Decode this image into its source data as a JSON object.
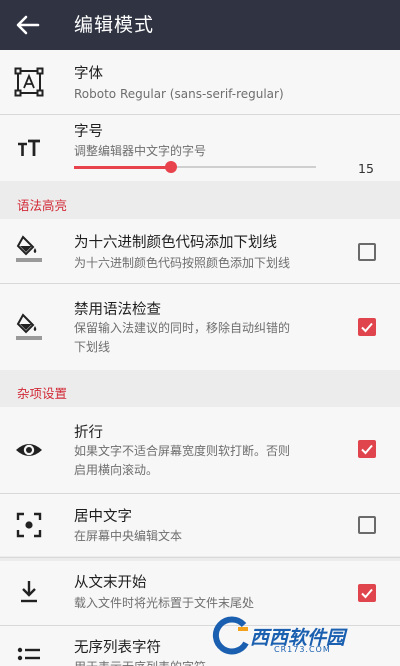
{
  "appbar": {
    "title": "编辑模式"
  },
  "settings": {
    "font": {
      "title": "字体",
      "subtitle": "Roboto Regular (sans-serif-regular)"
    },
    "font_size": {
      "title": "字号",
      "subtitle": "调整编辑器中文字的字号",
      "value": "15",
      "slider_fraction": 0.4
    }
  },
  "syntax_section": {
    "header": "语法高亮",
    "underline_hex": {
      "title": "为十六进制颜色代码添加下划线",
      "subtitle": "为十六进制颜色代码按照颜色添加下划线",
      "checked": false
    },
    "disable_spellcheck": {
      "title": "禁用语法检查",
      "subtitle_line1": "保留输入法建议的同时，移除自动纠错的",
      "subtitle_line2": "下划线",
      "checked": true
    }
  },
  "misc_section": {
    "header": "杂项设置",
    "word_wrap": {
      "title": "折行",
      "subtitle_line1": "如果文字不适合屏幕宽度则软打断。否则",
      "subtitle_line2": "启用横向滚动。",
      "checked": true
    },
    "center_text": {
      "title": "居中文字",
      "subtitle": "在屏幕中央编辑文本",
      "checked": false
    },
    "start_at_end": {
      "title": "从文末开始",
      "subtitle": "载入文件时将光标置于文件末尾处",
      "checked": true
    },
    "bullet_list": {
      "title": "无序列表字符",
      "subtitle": "用于表示无序列表的字符"
    }
  },
  "watermark": {
    "text": "西西软件园",
    "sub": "CR173.COM"
  },
  "colors": {
    "appbar": "#2f3342",
    "accent": "#e0444d",
    "section": "#d22a37"
  }
}
